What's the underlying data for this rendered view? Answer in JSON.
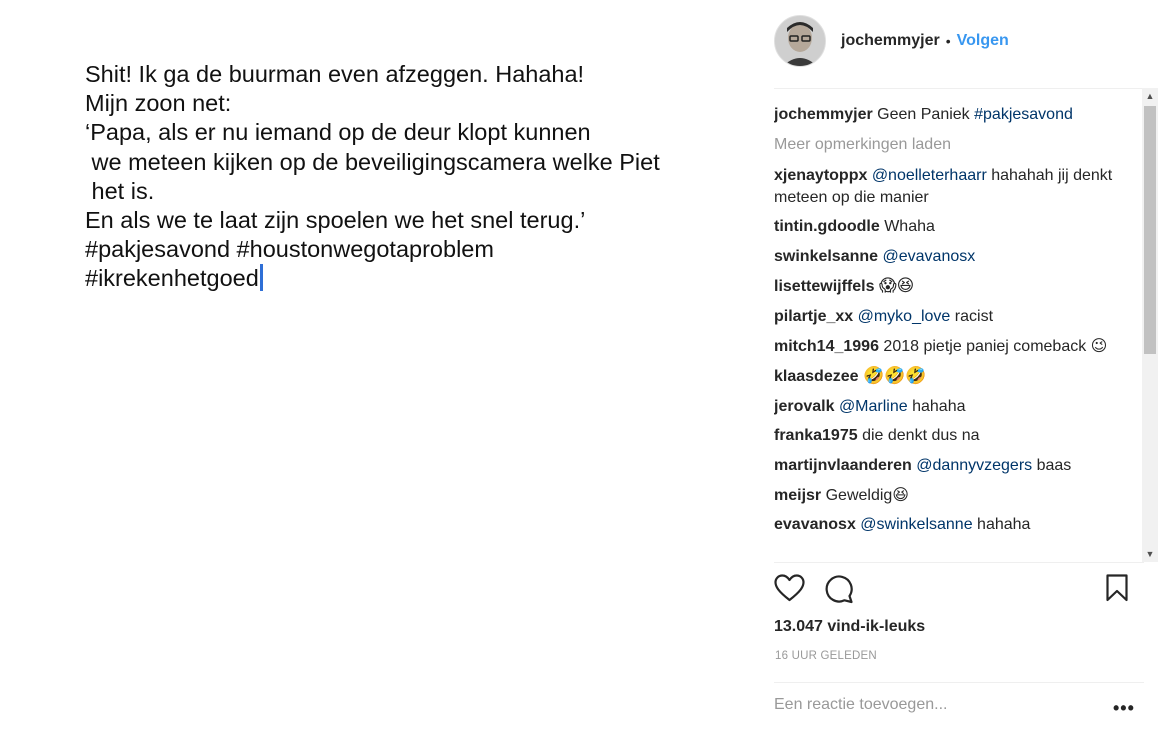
{
  "post": {
    "text_lines": [
      "Shit! Ik ga de buurman even afzeggen. Hahaha!",
      "Mijn zoon net:",
      "‘Papa, als er nu iemand op de deur klopt kunnen",
      " we meteen kijken op de beveiligingscamera welke Piet",
      " het is.",
      "En als we te laat zijn spoelen we het snel terug.’",
      "#pakjesavond #houstonwegotaproblem",
      "#ikrekenhetgoed"
    ]
  },
  "header": {
    "username": "jochemmyjer",
    "separator": "•",
    "follow_label": "Volgen"
  },
  "caption": {
    "user": "jochemmyjer",
    "text": "Geen Paniek ",
    "tag": "#pakjesavond"
  },
  "load_more_label": "Meer opmerkingen laden",
  "comments": [
    {
      "user": "xjenaytoppx",
      "mention": "@noelleterhaarr",
      "text": "hahahah jij denkt meteen op die manier"
    },
    {
      "user": "tintin.gdoodle",
      "mention": "",
      "text": "Whaha"
    },
    {
      "user": "swinkelsanne",
      "mention": "@evavanosx",
      "text": ""
    },
    {
      "user": "lisettewijffels",
      "mention": "",
      "text": "😱😆"
    },
    {
      "user": "pilartje_xx",
      "mention": "@myko_love",
      "text": "racist"
    },
    {
      "user": "mitch14_1996",
      "mention": "",
      "text": "2018 pietje paniej comeback 😉"
    },
    {
      "user": "klaasdezee",
      "mention": "",
      "text": "🤣🤣🤣"
    },
    {
      "user": "jerovalk",
      "mention": "@Marline",
      "text": "hahaha"
    },
    {
      "user": "franka1975",
      "mention": "",
      "text": "die denkt dus na"
    },
    {
      "user": "martijnvlaanderen",
      "mention": "@dannyvzegers",
      "text": "baas"
    },
    {
      "user": "meijsr",
      "mention": "",
      "text": "Geweldig😆"
    },
    {
      "user": "evavanosx",
      "mention": "@swinkelsanne",
      "text": "hahaha"
    }
  ],
  "actions": {
    "like_icon": "heart-icon",
    "comment_icon": "comment-bubble-icon",
    "save_icon": "bookmark-icon"
  },
  "likes_label": "13.047 vind-ik-leuks",
  "timestamp": "16 UUR GELEDEN",
  "add_comment_placeholder": "Een reactie toevoegen...",
  "more_options": "•••",
  "colors": {
    "link_blue": "#3897f0",
    "mention_blue": "#003569",
    "muted_gray": "#999999",
    "text": "#262626"
  }
}
